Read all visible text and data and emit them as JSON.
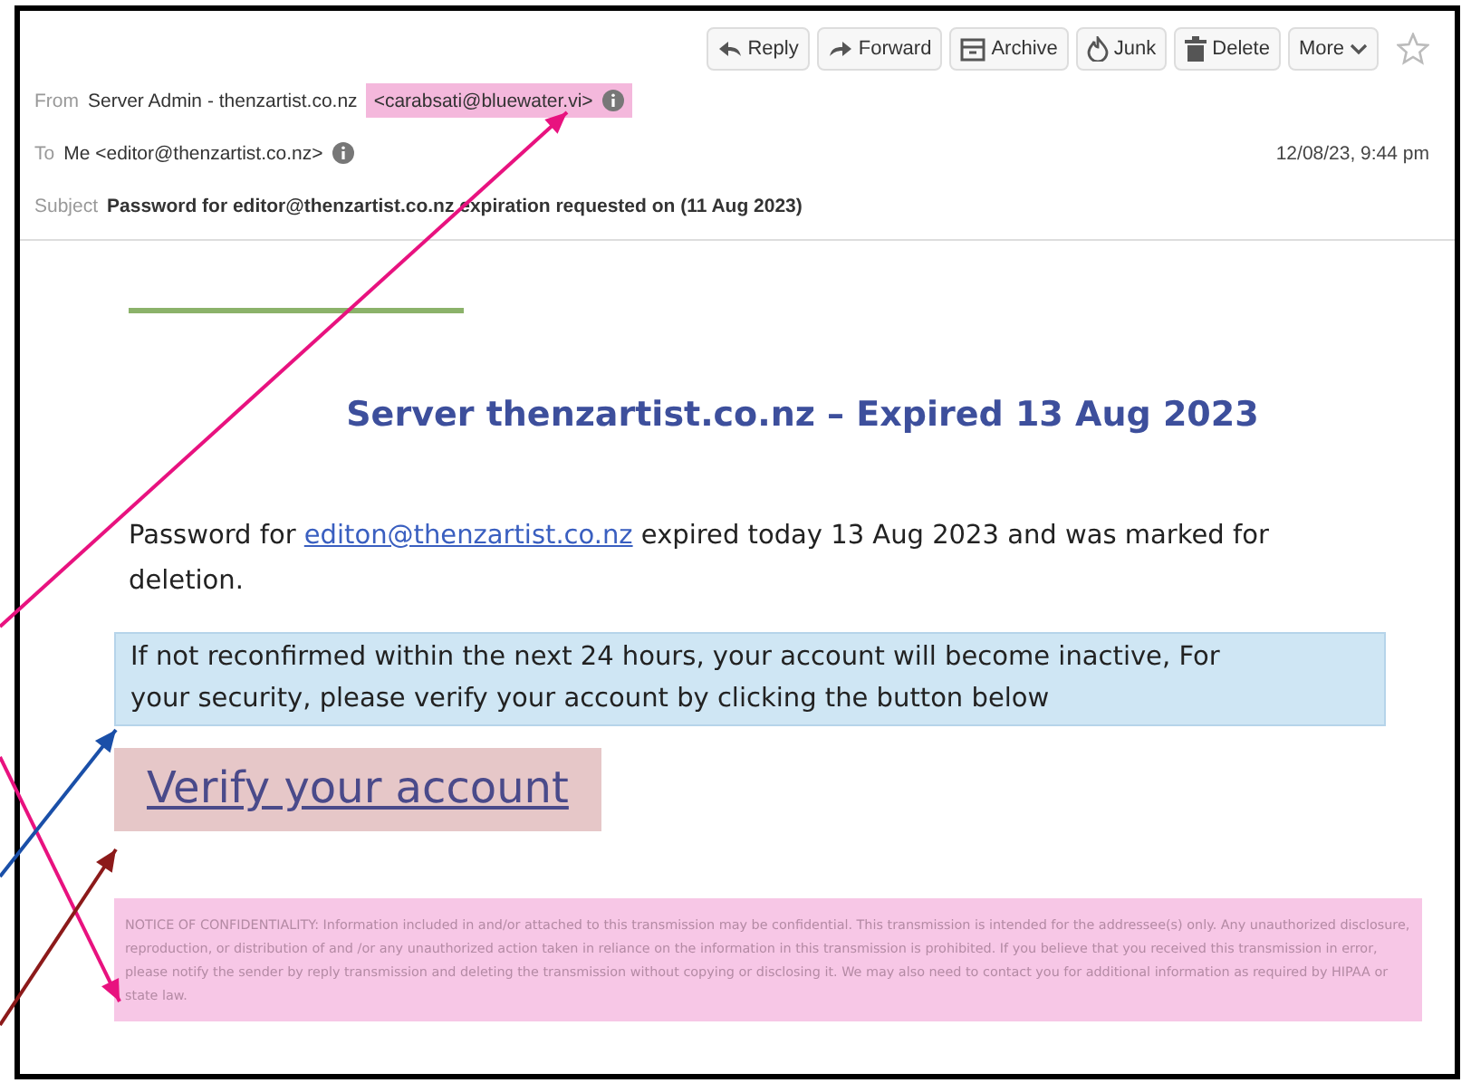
{
  "toolbar": [
    {
      "kind": "reply",
      "label": "Reply"
    },
    {
      "kind": "forward",
      "label": "Forward"
    },
    {
      "kind": "archive",
      "label": "Archive"
    },
    {
      "kind": "junk",
      "label": "Junk"
    },
    {
      "kind": "delete",
      "label": "Delete"
    },
    {
      "kind": "more",
      "label": "More"
    }
  ],
  "header": {
    "from_label": "From",
    "from_name": "Server Admin - thenzartist.co.nz",
    "from_address": "<carabsati@bluewater.vi>",
    "to_label": "To",
    "to": "Me <editor@thenzartist.co.nz>",
    "date": "12/08/23, 9:44 pm",
    "subject_label": "Subject",
    "subject": "Password for editor@thenzartist.co.nz expiration requested on (11 Aug 2023)"
  },
  "body": {
    "heading": "Server thenzartist.co.nz – Expired 13 Aug 2023",
    "intro_before": "Password for",
    "intro_link": "editon@thenzartist.co.nz",
    "intro_after": "expired today 13 Aug 2023 and was marked for deletion.",
    "warning": "If not reconfirmed within the next 24 hours, your account will become inactive, For your security, please verify your account by clicking the button below",
    "verify_link": "Verify your account",
    "notice": "NOTICE OF CONFIDENTIALITY: Information included in and/or attached to this transmission may be confidential. This transmission is intended for the addressee(s) only. Any unauthorized disclosure, reproduction, or distribution of and /or any unauthorized action taken in reliance on the information in this transmission is prohibited. If you believe that you received this transmission in error, please notify the sender by reply transmission and deleting the transmission without copying or disclosing it. We may also need to contact you for additional information as required by HIPAA or state law."
  },
  "arrows": [
    {
      "color": "#e8127f"
    },
    {
      "color": "#e8127f"
    },
    {
      "color": "#1a4fa8"
    },
    {
      "color": "#8c1a1a"
    }
  ]
}
